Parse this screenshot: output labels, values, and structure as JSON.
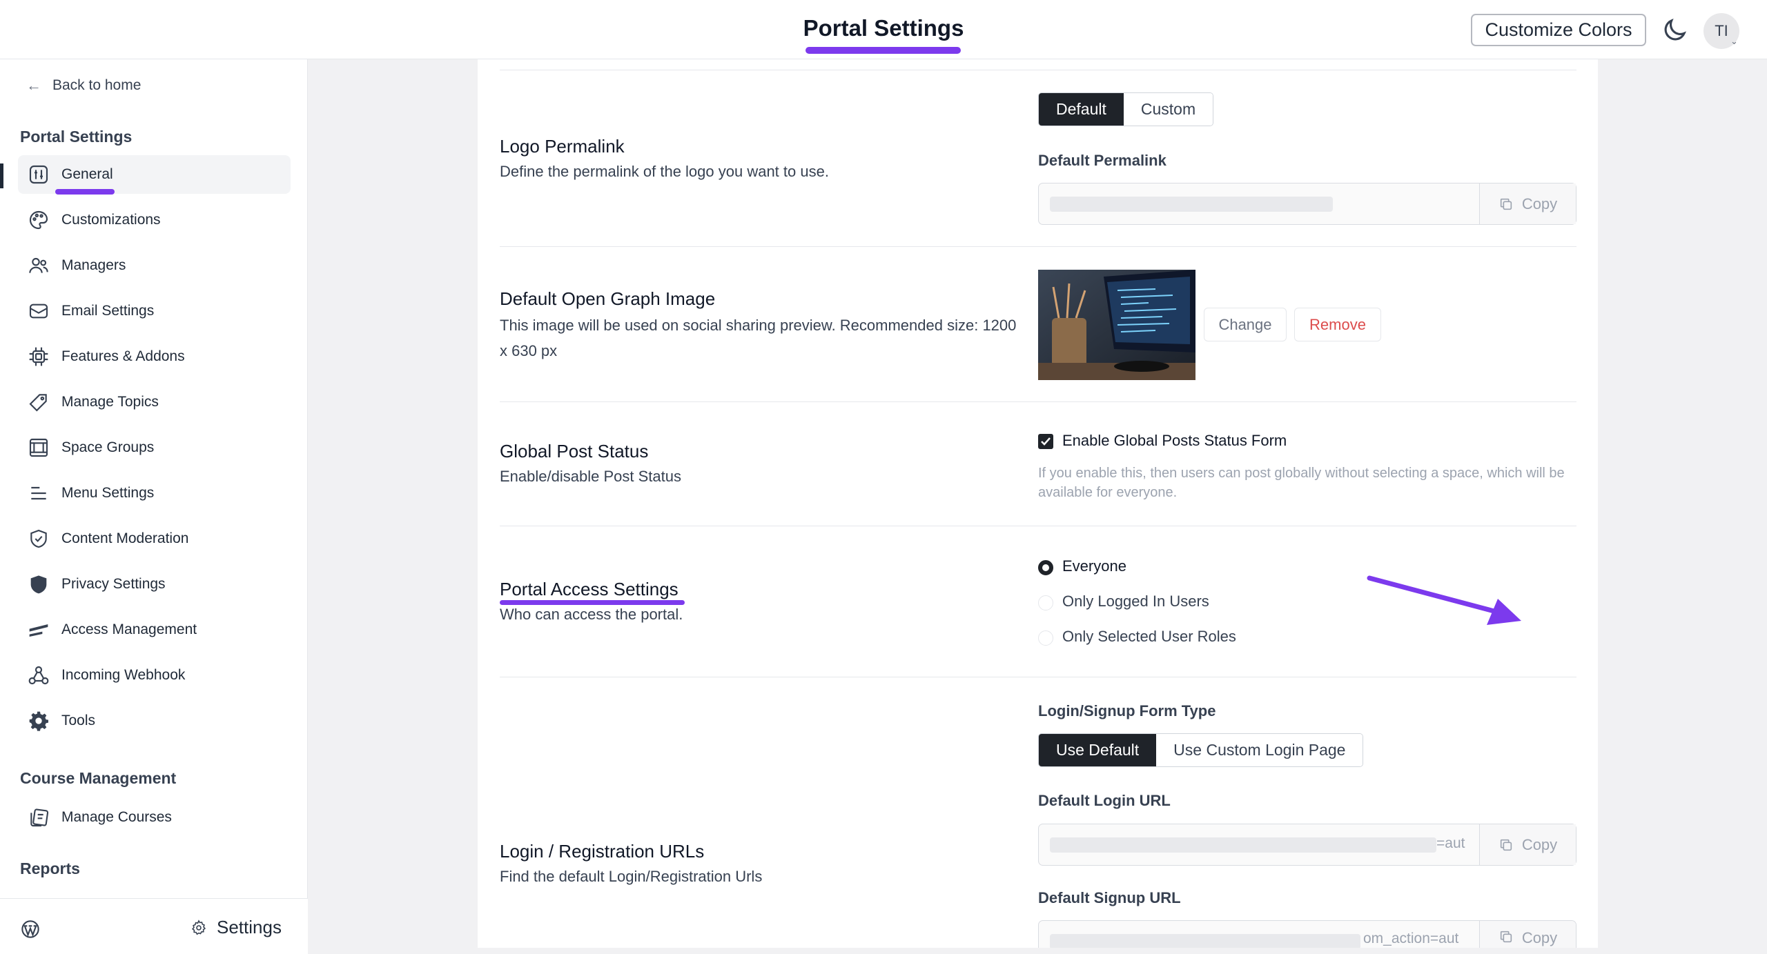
{
  "header": {
    "title": "Portal Settings",
    "customize_label": "Customize Colors",
    "avatar_initials": "TI",
    "accent_color": "#7c3aed"
  },
  "sidebar": {
    "back_label": "Back to home",
    "portal_section": "Portal Settings",
    "items": [
      {
        "label": "General",
        "icon": "sliders-icon"
      },
      {
        "label": "Customizations",
        "icon": "palette-icon"
      },
      {
        "label": "Managers",
        "icon": "users-icon"
      },
      {
        "label": "Email Settings",
        "icon": "mail-icon"
      },
      {
        "label": "Features & Addons",
        "icon": "chip-icon"
      },
      {
        "label": "Manage Topics",
        "icon": "tag-icon"
      },
      {
        "label": "Space Groups",
        "icon": "grid-icon"
      },
      {
        "label": "Menu Settings",
        "icon": "menu-icon"
      },
      {
        "label": "Content Moderation",
        "icon": "shield-check-icon"
      },
      {
        "label": "Privacy Settings",
        "icon": "shield-icon"
      },
      {
        "label": "Access Management",
        "icon": "key-icon"
      },
      {
        "label": "Incoming Webhook",
        "icon": "webhook-icon"
      },
      {
        "label": "Tools",
        "icon": "gear-icon"
      }
    ],
    "course_section": "Course Management",
    "course_items": [
      {
        "label": "Manage Courses",
        "icon": "courses-icon"
      }
    ],
    "reports_section": "Reports",
    "footer_settings": "Settings"
  },
  "main": {
    "logo_permalink": {
      "title": "Logo Permalink",
      "desc": "Define the permalink of the logo you want to use.",
      "options": [
        "Default",
        "Custom"
      ],
      "field_label": "Default Permalink",
      "copy_label": "Copy"
    },
    "og_image": {
      "title": "Default Open Graph Image",
      "desc": "This image will be used on social sharing preview. Recommended size: 1200 x 630 px",
      "change_label": "Change",
      "remove_label": "Remove"
    },
    "global_post": {
      "title": "Global Post Status",
      "desc": "Enable/disable Post Status",
      "checkbox_label": "Enable Global Posts Status Form",
      "help": "If you enable this, then users can post globally without selecting a space, which will be available for everyone."
    },
    "portal_access": {
      "title": "Portal Access Settings",
      "desc": "Who can access the portal.",
      "options": [
        "Everyone",
        "Only Logged In Users",
        "Only Selected User Roles"
      ],
      "selected": "Everyone"
    },
    "login_urls": {
      "title": "Login / Registration URLs",
      "desc": "Find the default Login/Registration Urls",
      "form_type_label": "Login/Signup Form Type",
      "form_options": [
        "Use Default",
        "Use Custom Login Page"
      ],
      "login_label": "Default Login URL",
      "login_tail": "=aut",
      "signup_label": "Default Signup URL",
      "signup_tail": "om_action=aut",
      "copy_label": "Copy"
    }
  }
}
